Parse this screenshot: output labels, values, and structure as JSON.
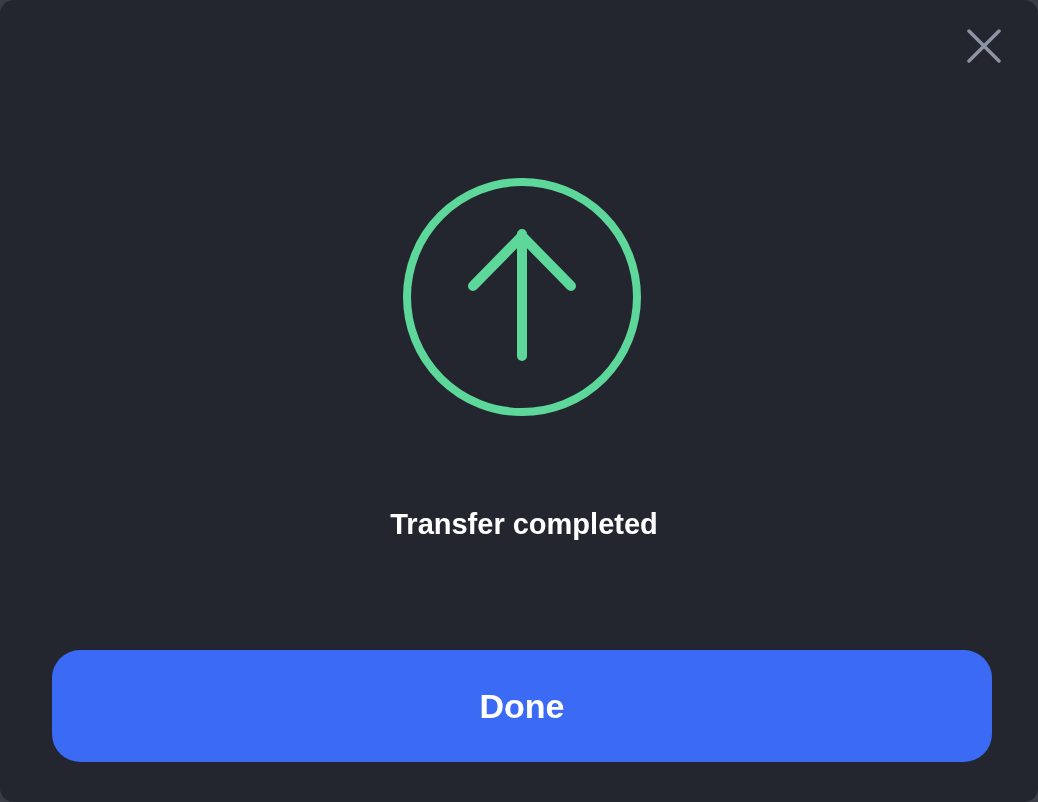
{
  "dialog": {
    "message": "Transfer completed",
    "button": "Done"
  }
}
